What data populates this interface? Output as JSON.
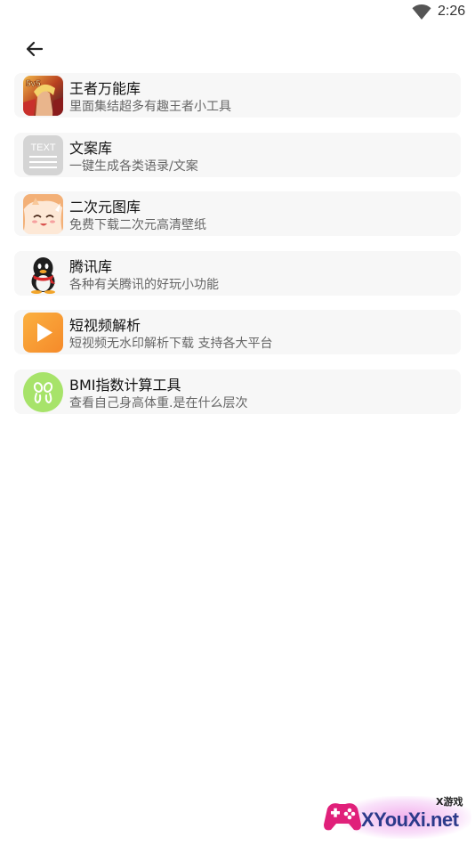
{
  "status_bar": {
    "time": "2:26",
    "wifi_icon": "wifi-icon"
  },
  "header": {
    "back_icon": "back-arrow-icon"
  },
  "tools": [
    {
      "title": "王者万能库",
      "subtitle": "里面集结超多有趣王者小工具",
      "icon": "hero-portrait-icon",
      "icon_badge": "5v5"
    },
    {
      "title": "文案库",
      "subtitle": "一键生成各类语录/文案",
      "icon": "text-document-icon",
      "icon_label": "TEXT"
    },
    {
      "title": "二次元图库",
      "subtitle": "免费下载二次元高清壁纸",
      "icon": "anime-girl-icon"
    },
    {
      "title": "腾讯库",
      "subtitle": "各种有关腾讯的好玩小功能",
      "icon": "penguin-icon"
    },
    {
      "title": "短视频解析",
      "subtitle": "短视频无水印解析下载 支持各大平台",
      "icon": "play-icon"
    },
    {
      "title": "BMI指数计算工具",
      "subtitle": "查看自己身高体重.是在什么层次",
      "icon": "bmi-icon"
    }
  ],
  "watermark": {
    "small_text": "X游戏",
    "site_text": "XYouXi.net",
    "icon": "gamepad-logo-icon"
  },
  "colors": {
    "card_bg": "#f7f7f7",
    "play_orange": "#f99a2d",
    "bmi_green": "#a7e36a"
  }
}
